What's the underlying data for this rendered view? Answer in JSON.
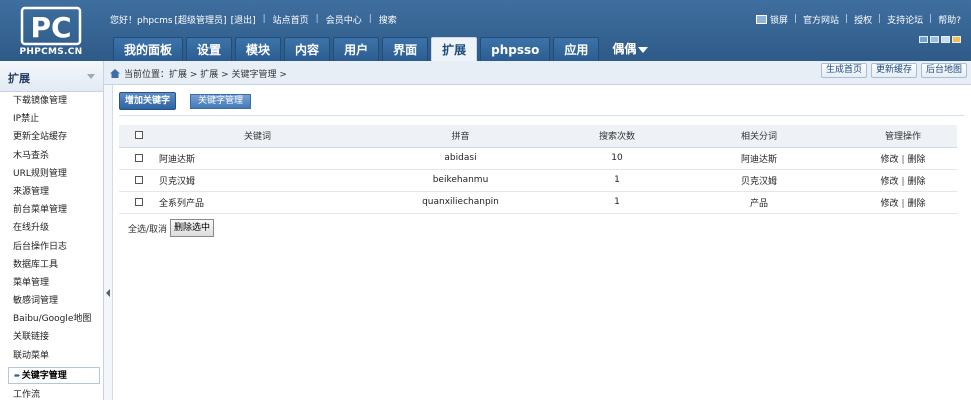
{
  "logo": {
    "mark": "PC",
    "text": "PHPCMS.CN"
  },
  "topbar": {
    "greeting": "您好！phpcms",
    "role": "[超级管理员]",
    "logout": "[退出]",
    "site_home": "站点首页",
    "member_center": "会员中心",
    "search": "搜索"
  },
  "topright": {
    "lock": "锁屏",
    "official": "官方网站",
    "license": "授权",
    "forum": "支持论坛",
    "help": "帮助?"
  },
  "skin_colors": [
    "#6fa2d6",
    "#9bbfe2",
    "#c9dbee",
    "#f0c04a"
  ],
  "nav": {
    "tabs": [
      "我的面板",
      "设置",
      "模块",
      "内容",
      "用户",
      "界面",
      "扩展",
      "phpsso",
      "应用"
    ],
    "active": "扩展",
    "user": "偶偶"
  },
  "sidebar": {
    "title": "扩展",
    "items": [
      "下载镜像管理",
      "IP禁止",
      "更新全站缓存",
      "木马查杀",
      "URL规则管理",
      "来源管理",
      "前台菜单管理",
      "在线升级",
      "后台操作日志",
      "数据库工具",
      "菜单管理",
      "敏感词管理",
      "Baibu/Google地图",
      "关联链接",
      "联动菜单"
    ],
    "active": "关键字管理",
    "after": "工作流"
  },
  "breadcrumb": {
    "prefix": "当前位置：扩展 > 扩展 > 关键字管理 >",
    "btn_home": "生成首页",
    "btn_cache": "更新缓存",
    "btn_map": "后台地图"
  },
  "actions": {
    "add": "增加关键字",
    "manage": "关键字管理"
  },
  "table": {
    "headers": [
      "关键词",
      "拼音",
      "搜索次数",
      "相关分词",
      "管理操作"
    ],
    "rows": [
      {
        "keyword": "阿迪达斯",
        "pinyin": "abidasi",
        "count": "10",
        "related": "阿迪达斯"
      },
      {
        "keyword": "贝克汉姆",
        "pinyin": "beikehanmu",
        "count": "1",
        "related": "贝克汉姆"
      },
      {
        "keyword": "全系列产品",
        "pinyin": "quanxiliechanpin",
        "count": "1",
        "related": "产品"
      }
    ],
    "op_edit": "修改",
    "op_sep": "|",
    "op_delete": "删除"
  },
  "footer": {
    "select_all": "全选/取消",
    "delete_selected": "删除选中"
  }
}
